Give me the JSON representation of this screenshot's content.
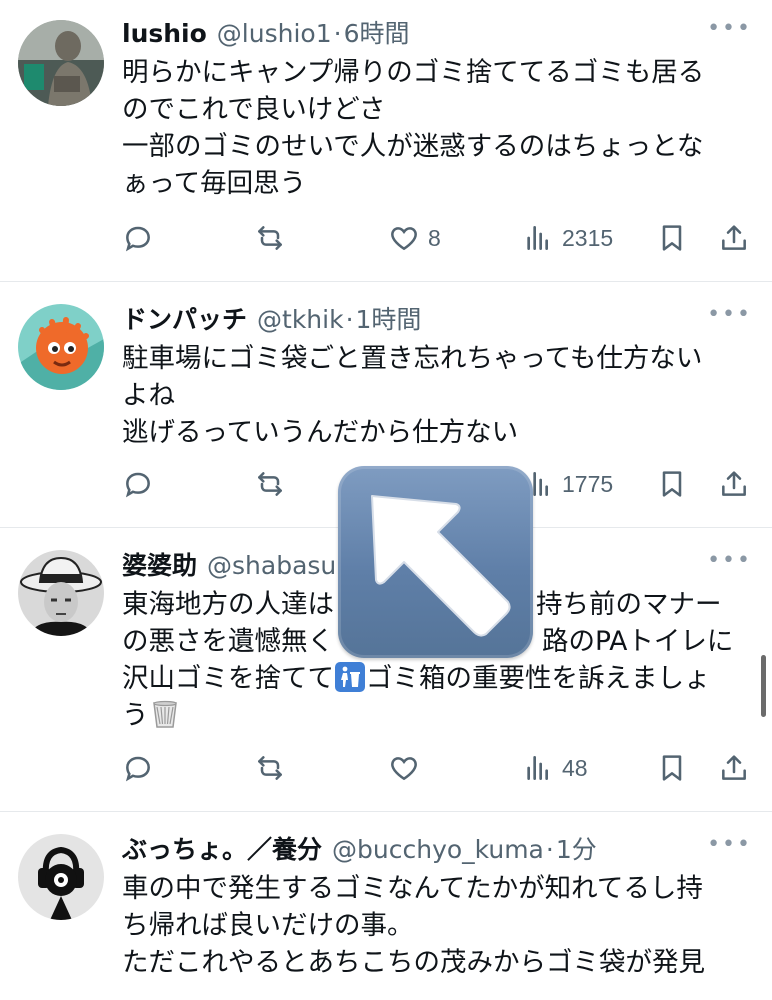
{
  "posts": [
    {
      "name": "lushio",
      "handle": "@lushio1",
      "dot": "·",
      "time": "6時間",
      "lines": [
        "明らかにキャンプ帰りのゴミ捨ててるゴミも居る",
        "のでこれで良いけどさ",
        "一部のゴミのせいで人が迷惑するのはちょっとな",
        "ぁって毎回思う"
      ],
      "likes": "8",
      "views": "2315"
    },
    {
      "name": "ドンパッチ",
      "handle": "@tkhik",
      "dot": "·",
      "time": "1時間",
      "lines": [
        "駐車場にゴミ袋ごと置き忘れちゃっても仕方ない",
        "よね",
        "逃げるっていうんだから仕方ない"
      ],
      "likes": "",
      "views": "1775"
    },
    {
      "name": "婆婆助",
      "handle": "@shabasu",
      "dot": "",
      "time": "",
      "lines": [
        "東海地方の人達は",
        "持ち前のマナー",
        "の悪さを遺憾無く",
        "路のPAトイレに",
        "沢山ゴミを捨てて",
        "ゴミ箱の重要性を訴えましょ",
        "う"
      ],
      "likes": "",
      "views": "48"
    },
    {
      "name": "ぶっちょ。／養分",
      "handle": "@bucchyo_kuma",
      "dot": "·",
      "time": "1分",
      "lines": [
        "車の中で発生するゴミなんてたかが知れてるし持",
        "ち帰れば良いだけの事。",
        "ただこれやるとあちこちの茂みからゴミ袋が発見"
      ],
      "likes": "",
      "views": ""
    }
  ],
  "more_label": "•••",
  "icons": {
    "reply": "reply-icon",
    "repost": "repost-icon",
    "like": "heart-icon",
    "views": "views-icon",
    "bookmark": "bookmark-icon",
    "share": "share-icon",
    "overlay": "arrow-up-left-icon",
    "trash_person": "put-litter-in-its-place-icon",
    "wastebasket": "wastebasket-icon"
  }
}
